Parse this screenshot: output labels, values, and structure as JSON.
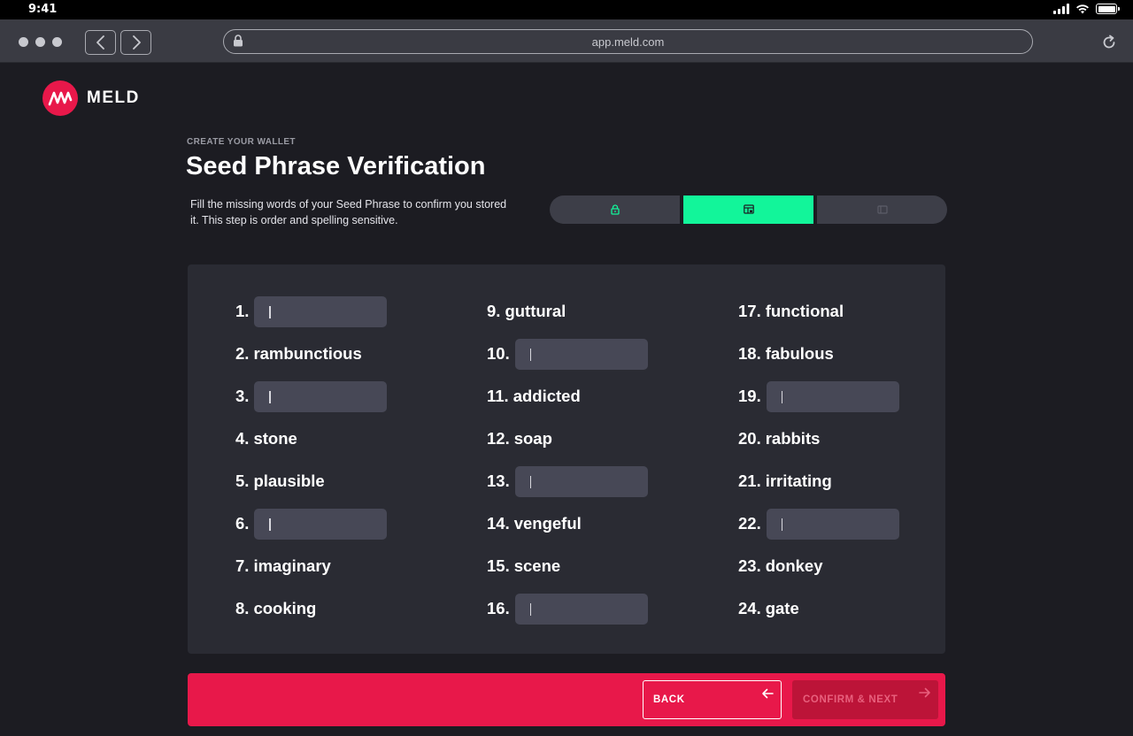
{
  "status_bar": {
    "time": "9:41"
  },
  "browser": {
    "url": "app.meld.com"
  },
  "brand": {
    "name": "MELD",
    "accent": "#e8184a",
    "success": "#12f59a"
  },
  "header": {
    "eyebrow": "CREATE YOUR WALLET",
    "title": "Seed Phrase Verification",
    "description": "Fill the missing words of your Seed Phrase to confirm you stored it. This step is order and spelling sensitive."
  },
  "stepper": {
    "steps": [
      {
        "icon": "lock-icon",
        "state": "done"
      },
      {
        "icon": "seed-grid-icon",
        "state": "active"
      },
      {
        "icon": "wallet-icon",
        "state": "pending"
      }
    ]
  },
  "words": [
    {
      "num": "1.",
      "word": "",
      "missing": true
    },
    {
      "num": "2.",
      "word": "rambunctious",
      "missing": false
    },
    {
      "num": "3.",
      "word": "",
      "missing": true
    },
    {
      "num": "4.",
      "word": "stone",
      "missing": false
    },
    {
      "num": "5.",
      "word": "plausible",
      "missing": false
    },
    {
      "num": "6.",
      "word": "",
      "missing": true
    },
    {
      "num": "7.",
      "word": "imaginary",
      "missing": false
    },
    {
      "num": "8.",
      "word": "cooking",
      "missing": false
    },
    {
      "num": "9.",
      "word": "guttural",
      "missing": false
    },
    {
      "num": "10.",
      "word": "",
      "missing": true
    },
    {
      "num": "11.",
      "word": "addicted",
      "missing": false
    },
    {
      "num": "12.",
      "word": "soap",
      "missing": false
    },
    {
      "num": "13.",
      "word": "",
      "missing": true
    },
    {
      "num": "14.",
      "word": "vengeful",
      "missing": false
    },
    {
      "num": "15.",
      "word": "scene",
      "missing": false
    },
    {
      "num": "16.",
      "word": "",
      "missing": true
    },
    {
      "num": "17.",
      "word": "functional",
      "missing": false
    },
    {
      "num": "18.",
      "word": "fabulous",
      "missing": false
    },
    {
      "num": "19.",
      "word": "",
      "missing": true
    },
    {
      "num": "20.",
      "word": "rabbits",
      "missing": false
    },
    {
      "num": "21.",
      "word": "irritating",
      "missing": false
    },
    {
      "num": "22.",
      "word": "",
      "missing": true
    },
    {
      "num": "23.",
      "word": "donkey",
      "missing": false
    },
    {
      "num": "24.",
      "word": "gate",
      "missing": false
    }
  ],
  "footer": {
    "back_label": "BACK",
    "next_label": "CONFIRM & NEXT"
  }
}
